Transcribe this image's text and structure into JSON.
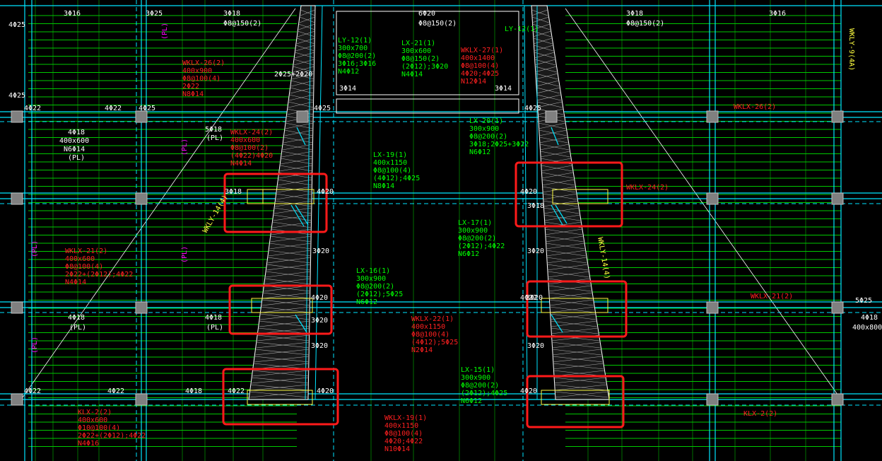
{
  "colors": {
    "background": "#000000",
    "grid_axis": "#00ffff",
    "slab_rebar": "#00ff00",
    "beam_label_frame": "#ff2020",
    "beam_label_internal": "#00ff00",
    "column_fill": "#808080",
    "yellow": "#ffff40",
    "white": "#ffffff",
    "magenta": "#ff00ff",
    "highlight_box": "#ff1a1a",
    "dashed": "#00ffff"
  },
  "labels_white": [
    {
      "id": "t1",
      "text": "3Φ16"
    },
    {
      "id": "t2",
      "text": "3Φ25"
    },
    {
      "id": "t3",
      "text": "3Φ18"
    },
    {
      "id": "t4",
      "text": "Φ8@150(2)"
    },
    {
      "id": "t5",
      "text": "6Φ20"
    },
    {
      "id": "t6",
      "text": "Φ8@150(2)"
    },
    {
      "id": "t7",
      "text": "3Φ18"
    },
    {
      "id": "t8",
      "text": "Φ8@150(2)"
    },
    {
      "id": "t9",
      "text": "3Φ16"
    },
    {
      "id": "t10",
      "text": "4Φ22"
    },
    {
      "id": "t11",
      "text": "4Φ22"
    },
    {
      "id": "t12",
      "text": "4Φ25"
    },
    {
      "id": "t13",
      "text": "4Φ25"
    },
    {
      "id": "t14",
      "text": "4Φ25"
    },
    {
      "id": "t15",
      "text": "4Φ18"
    },
    {
      "id": "t16",
      "text": "400x600"
    },
    {
      "id": "t17",
      "text": "N6Φ14"
    },
    {
      "id": "t18",
      "text": "(PL)"
    },
    {
      "id": "t19",
      "text": "5Φ18"
    },
    {
      "id": "t20",
      "text": "(PL)"
    },
    {
      "id": "t21",
      "text": "4Φ20"
    },
    {
      "id": "t22",
      "text": "3Φ18"
    },
    {
      "id": "t23",
      "text": "4Φ20"
    },
    {
      "id": "t24",
      "text": "3Φ18"
    },
    {
      "id": "t25",
      "text": "3Φ20"
    },
    {
      "id": "t26",
      "text": "3Φ20"
    },
    {
      "id": "t27",
      "text": "4Φ20"
    },
    {
      "id": "t28",
      "text": "3Φ20"
    },
    {
      "id": "t29",
      "text": "3Φ20"
    },
    {
      "id": "t30",
      "text": "4Φ18"
    },
    {
      "id": "t31",
      "text": "(PL)"
    },
    {
      "id": "t32",
      "text": "4Φ18"
    },
    {
      "id": "t33",
      "text": "(PL)"
    },
    {
      "id": "t34",
      "text": "4Φ22"
    },
    {
      "id": "t35",
      "text": "4Φ22"
    },
    {
      "id": "t36",
      "text": "4Φ22"
    },
    {
      "id": "t37",
      "text": "4Φ18"
    },
    {
      "id": "t38",
      "text": "4Φ20"
    },
    {
      "id": "t39",
      "text": "4Φ20"
    },
    {
      "id": "t40",
      "text": "5Φ25"
    },
    {
      "id": "t41",
      "text": "4Φ18"
    },
    {
      "id": "t42",
      "text": "400x800"
    },
    {
      "id": "t43",
      "text": "3Φ20"
    },
    {
      "id": "t44",
      "text": "3Φ20"
    },
    {
      "id": "t45",
      "text": "3Φ14"
    },
    {
      "id": "t46",
      "text": "3Φ14"
    },
    {
      "id": "t47",
      "text": "4Φ25"
    },
    {
      "id": "t48",
      "text": "4Φ25"
    },
    {
      "id": "t49",
      "text": "2Φ25+2Φ20"
    },
    {
      "id": "t50",
      "text": "4Φ22"
    }
  ],
  "labels_red": [
    {
      "id": "r1",
      "lines": [
        "WKLX-26(2)",
        "400x900",
        "Φ8@100(4)",
        "2Φ22",
        "N8Φ14"
      ]
    },
    {
      "id": "r2",
      "lines": [
        "WKLX-24(2)",
        "400x600",
        "Φ8@100(2)",
        "(4Φ22)4Φ20",
        "N4Φ14"
      ]
    },
    {
      "id": "r3",
      "lines": [
        "WKLX-27(1)",
        "400x1400",
        "Φ8@100(4)",
        "4Φ20;4Φ25",
        "N12Φ14"
      ]
    },
    {
      "id": "r4",
      "lines": [
        "WKLX-26(2)"
      ]
    },
    {
      "id": "r5",
      "lines": [
        "WKLX-24(2)"
      ]
    },
    {
      "id": "r6",
      "lines": [
        "WKLX-21(2)",
        "400x600",
        "Φ8@100(4)",
        "2Φ22+(2Φ12);4Φ22",
        "N4Φ14"
      ]
    },
    {
      "id": "r7",
      "lines": [
        "WKLX-22(1)",
        "400x1150",
        "Φ8@100(4)",
        "(4Φ12);5Φ25",
        "N2Φ14"
      ]
    },
    {
      "id": "r8",
      "lines": [
        "WKLX-21(2)"
      ]
    },
    {
      "id": "r9",
      "lines": [
        "KLX-2(2)",
        "400x600",
        "Φ10@100(4)",
        "2Φ22+(2Φ12);4Φ22",
        "N4Φ16"
      ]
    },
    {
      "id": "r10",
      "lines": [
        "WKLX-19(1)",
        "400x1150",
        "Φ8@100(4)",
        "4Φ20;4Φ22",
        "N10Φ14"
      ]
    },
    {
      "id": "r11",
      "lines": [
        "KLX-2(2)"
      ]
    }
  ],
  "labels_green": [
    {
      "id": "g1",
      "lines": [
        "LX-21(1)",
        "300x600",
        "Φ8@150(2)",
        "(2Φ12);3Φ20",
        "N4Φ14"
      ]
    },
    {
      "id": "g2",
      "lines": [
        "LX-20(1)",
        "300x900",
        "Φ8@200(2)",
        "3Φ18;2Φ25+3Φ22",
        "N6Φ12"
      ]
    },
    {
      "id": "g3",
      "lines": [
        "LX-19(1)",
        "400x1150",
        "Φ8@100(4)",
        "(4Φ12);4Φ25",
        "N8Φ14"
      ]
    },
    {
      "id": "g4",
      "lines": [
        "LX-17(1)",
        "300x900",
        "Φ8@200(2)",
        "(2Φ12);4Φ22",
        "N6Φ12"
      ]
    },
    {
      "id": "g5",
      "lines": [
        "LX-16(1)",
        "300x900",
        "Φ8@200(2)",
        "(2Φ12);5Φ25",
        "N6Φ12"
      ]
    },
    {
      "id": "g6",
      "lines": [
        "LX-15(1)",
        "300x900",
        "Φ8@200(2)",
        "(2Φ12);4Φ25",
        "N6Φ12"
      ]
    },
    {
      "id": "g7",
      "lines": [
        "LY-12(1)",
        "300x700",
        "Φ8@200(2)",
        "3Φ16;3Φ16",
        "N4Φ12"
      ]
    },
    {
      "id": "g8",
      "lines": [
        "LY-12(1)"
      ]
    }
  ],
  "labels_yellow": [
    {
      "id": "y1",
      "text": "WKLY-9(4A)"
    },
    {
      "id": "y2",
      "text": "WKLY-14(4)"
    },
    {
      "id": "y3",
      "text": "WKLY-14(4)"
    }
  ],
  "labels_magenta": [
    {
      "id": "m1",
      "text": "(PL)"
    },
    {
      "id": "m2",
      "text": "(PL)"
    },
    {
      "id": "m3",
      "text": "(PL)"
    },
    {
      "id": "m4",
      "text": "(PL)"
    },
    {
      "id": "m5",
      "text": "(PL)"
    }
  ],
  "highlight_boxes": 6
}
